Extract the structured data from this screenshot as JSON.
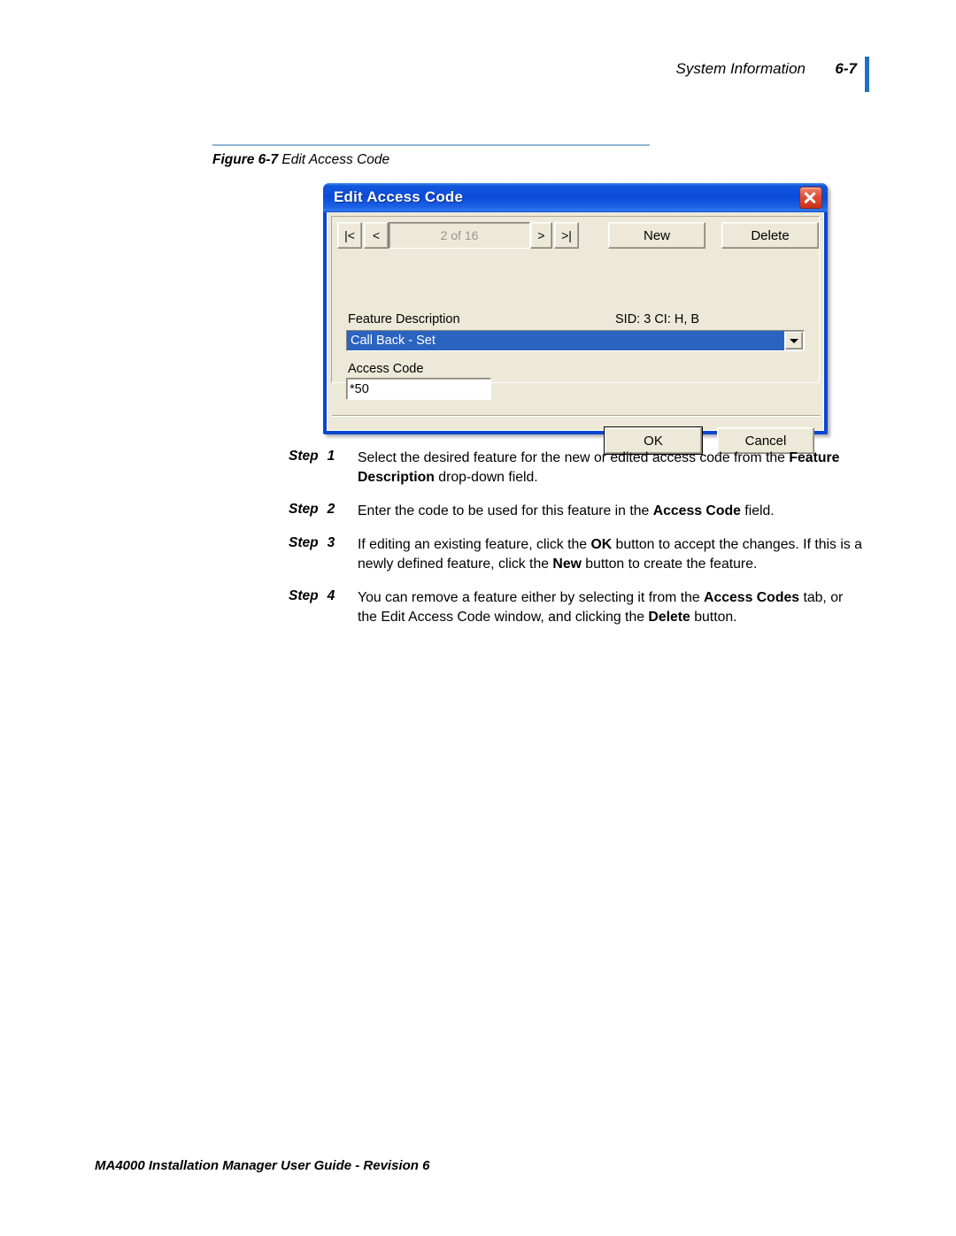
{
  "page": {
    "header_title": "System Information",
    "page_number": "6-7",
    "footer": "MA4000 Installation Manager User Guide - Revision 6",
    "accent_color": "#1f6fc4",
    "rule_color": "#8fb8d6"
  },
  "figure": {
    "label": "Figure 6-7",
    "caption": "Edit Access Code"
  },
  "dialog": {
    "title": "Edit Access Code",
    "close_icon": "close-icon",
    "titlebar_color": "#0b4ad9",
    "nav": {
      "first_label": "|<",
      "prev_label": "<",
      "position": "2 of 16",
      "next_label": ">",
      "last_label": ">|"
    },
    "buttons": {
      "new": "New",
      "delete": "Delete",
      "ok": "OK",
      "cancel": "Cancel"
    },
    "feature_description": {
      "label": "Feature Description",
      "meta": "SID: 3   CI: H, B",
      "value": "Call Back - Set",
      "highlight_color": "#2b63c0",
      "dropdown_icon": "chevron-down-icon"
    },
    "access_code": {
      "label": "Access Code",
      "value": "*50"
    }
  },
  "steps": [
    {
      "label": "Step",
      "number": "1",
      "html": "Select the desired feature for the new or edited access code from the <b>Feature Description</b> drop-down field."
    },
    {
      "label": "Step",
      "number": "2",
      "html": "Enter the code to be used for this feature in the <b>Access Code</b> field."
    },
    {
      "label": "Step",
      "number": "3",
      "html": "If editing an existing feature, click the <b>OK</b> button to accept the changes. If this is a newly defined feature, click the <b>New</b> button to create the feature."
    },
    {
      "label": "Step",
      "number": "4",
      "html": "You can remove a feature either by selecting it from the <b>Access Codes</b> tab, or the Edit Access Code window, and clicking the <b>Delete</b> button."
    }
  ]
}
